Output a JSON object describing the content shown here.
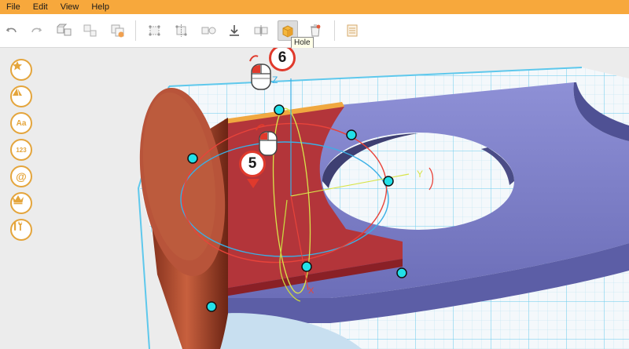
{
  "menu": {
    "items": [
      {
        "label": "File"
      },
      {
        "label": "Edit"
      },
      {
        "label": "View"
      },
      {
        "label": "Help"
      }
    ]
  },
  "toolbar": {
    "buttons": [
      {
        "icon": "undo-icon"
      },
      {
        "icon": "redo-icon"
      },
      {
        "icon": "group-icon"
      },
      {
        "icon": "ungroup-icon"
      },
      {
        "icon": "duplicate-icon"
      },
      {
        "icon": "align-icon"
      },
      {
        "icon": "mirror-icon"
      },
      {
        "icon": "solid-icon"
      },
      {
        "icon": "download-icon"
      },
      {
        "icon": "reflect-icon"
      },
      {
        "icon": "hole-icon",
        "active": true
      },
      {
        "icon": "delete-icon"
      },
      {
        "icon": "notes-icon"
      }
    ],
    "tooltip": "Hole"
  },
  "sidebar": {
    "items": [
      {
        "icon": "star-icon",
        "label": ""
      },
      {
        "icon": "shape-icon",
        "label": ""
      },
      {
        "icon": "text-icon",
        "label": "Aa"
      },
      {
        "icon": "number-icon",
        "label": "123"
      },
      {
        "icon": "at-icon",
        "label": "@"
      },
      {
        "icon": "crown-icon",
        "label": ""
      },
      {
        "icon": "tools-icon",
        "label": ""
      }
    ]
  },
  "callouts": [
    {
      "label": "6"
    },
    {
      "label": "5"
    }
  ],
  "axis_labels": {
    "z": "Z",
    "y": "Y",
    "x": "X"
  },
  "colors": {
    "menubar": "#f7a83c",
    "grid_lines": "#5ec8ec",
    "grid_fill": "#f4f8fb",
    "plate": "#7e80c6",
    "cylinder": "#b8543a",
    "box": "#b3353a",
    "handle": "#22e0e8",
    "callout_border": "#e03a2c",
    "accent": "#e4a53c"
  }
}
